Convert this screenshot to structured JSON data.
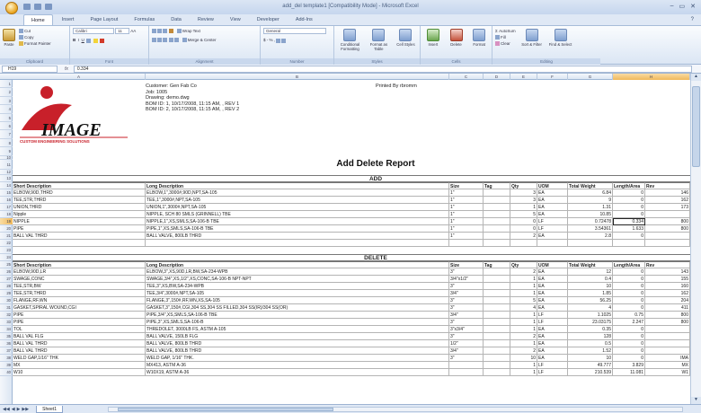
{
  "window": {
    "title": "add_del template1  [Compatibility Mode] - Microsoft Excel",
    "controls": [
      "–",
      "▭",
      "✕"
    ]
  },
  "ribbon": {
    "tabs": [
      "Home",
      "Insert",
      "Page Layout",
      "Formulas",
      "Data",
      "Review",
      "View",
      "Developer",
      "Add-Ins"
    ],
    "active_tab": "Home",
    "clipboard": {
      "paste": "Paste",
      "cut": "Cut",
      "copy": "Copy",
      "format_painter": "Format Painter",
      "label": "Clipboard"
    },
    "font": {
      "name": "Calibri",
      "size": "11",
      "label": "Font"
    },
    "alignment": {
      "wrap": "Wrap Text",
      "merge": "Merge & Center",
      "label": "Alignment"
    },
    "number": {
      "format": "General",
      "label": "Number"
    },
    "styles": {
      "conditional": "Conditional Formatting",
      "format_table": "Format as Table",
      "cell_styles": "Cell Styles",
      "label": "Styles"
    },
    "cells": {
      "insert": "Insert",
      "delete": "Delete",
      "format": "Format",
      "label": "Cells"
    },
    "editing": {
      "autosum": "AutoSum",
      "fill": "Fill",
      "clear": "Clear",
      "sort": "Sort & Filter",
      "find": "Find & Select",
      "label": "Editing"
    }
  },
  "formula_bar": {
    "cell_ref": "H19",
    "fx": "fx",
    "value": "0.334"
  },
  "columns": [
    "A",
    "B",
    "C",
    "D",
    "E",
    "F",
    "G",
    "H"
  ],
  "selected_column": "H",
  "selected_row": "19",
  "header": {
    "customer": "Customer:  Gen Fab Co",
    "job": "Job:  1005",
    "drawing": "Drawing:  demo.dwg",
    "bom1": "BOM ID:  1,  10/17/2008,  11:15 AM,  ,  REV 1",
    "bom2": "BOM ID:  2,  10/17/2008,  11:15 AM,  ,  REV 2",
    "printed_by": "Printed By rbromm",
    "logo_text": "IMAGE",
    "logo_sub": "CUSTOM ENGINEERING SOLUTIONS"
  },
  "report_title": "Add Delete Report",
  "add_section": {
    "label": "ADD",
    "headers": [
      "Short Description",
      "Long Description",
      "Size",
      "Tag",
      "Qty",
      "UOM",
      "Total Weight",
      "Length/Area",
      "Rev"
    ],
    "rows": [
      {
        "n": "14",
        "cells": []
      },
      {
        "n": "15",
        "cells": [
          "ELBOW,90D,THRD",
          "ELBOW,1\",3000#,90D,NPT,SA-105",
          "1\"",
          "",
          "3",
          "EA",
          "6.84",
          "0",
          "146"
        ]
      },
      {
        "n": "16",
        "cells": [
          "TEE,STR,THRD",
          "TEE,1\",3000#,NPT,SA-105",
          "1\"",
          "",
          "3",
          "EA",
          "9",
          "0",
          "162"
        ]
      },
      {
        "n": "17",
        "cells": [
          "UNION,THRD",
          "UNION,1\",3000#,NPT,SA-105",
          "1\"",
          "",
          "1",
          "EA",
          "1.31",
          "0",
          "173"
        ]
      },
      {
        "n": "18",
        "cells": [
          "Nipple",
          "NIPPLE, SCH 80 SMLS (GRINNELL) TBE",
          "1\"",
          "",
          "5",
          "EA",
          "10.85",
          "0",
          ""
        ]
      },
      {
        "n": "19",
        "cells": [
          "NIPPLE",
          "NIPPLE,1\",XS,SMLS,SA-106-B TBE",
          "1\"",
          "",
          "0",
          "LF",
          "0.72478",
          "0.334",
          "800"
        ]
      },
      {
        "n": "20",
        "cells": [
          "PIPE",
          "PIPE,1\",XS,SMLS,SA-106-B TBE",
          "1\"",
          "",
          "0",
          "LF",
          "3.54361",
          "1.633",
          "800"
        ]
      },
      {
        "n": "21",
        "cells": [
          "BALL VAL THRD",
          "BALL VALVE, 800LB THRD",
          "1\"",
          "",
          "2",
          "EA",
          "2.8",
          "0",
          ""
        ]
      }
    ]
  },
  "delete_section": {
    "label": "DELETE",
    "headers": [
      "Short Description",
      "Long Description",
      "Size",
      "Tag",
      "Qty",
      "UOM",
      "Total Weight",
      "Length/Area",
      "Rev"
    ],
    "rows": [
      {
        "n": "26",
        "cells": [
          "ELBOW,90D,LR",
          "ELBOW,3\",XS,90D,LR,BW,SA-234-WPB",
          "3\"",
          "",
          "2",
          "EA",
          "12",
          "0",
          "143"
        ]
      },
      {
        "n": "27",
        "cells": [
          "SWAGE,CONC",
          "SWAGE,3/4\",XS,1/2\",XS,CONC,SA-106-B NPT-NPT",
          "3/4\"x1/2\"",
          "",
          "1",
          "EA",
          "0.4",
          "0",
          "155"
        ]
      },
      {
        "n": "28",
        "cells": [
          "TEE,STR,BW",
          "TEE,3\",XS,BW,SA-234-WPB",
          "3\"",
          "",
          "1",
          "EA",
          "10",
          "0",
          "160"
        ]
      },
      {
        "n": "29",
        "cells": [
          "TEE,STR,THRD",
          "TEE,3/4\",3000#,NPT,SA-105",
          "3/4\"",
          "",
          "1",
          "EA",
          "1.85",
          "0",
          "162"
        ]
      },
      {
        "n": "30",
        "cells": [
          "FLANGE,RF,WN",
          "FLANGE,3\",150#,RF,WN,XS,SA-105",
          "3\"",
          "",
          "5",
          "EA",
          "56.25",
          "0",
          "204"
        ]
      },
      {
        "n": "31",
        "cells": [
          "GASKET,SPIRAL WOUND,CGI",
          "GASKET,3\",150#,CGI,304 SS,304 SS FILLED,304 SS(IR)/304 SS(OR)",
          "3\"",
          "",
          "4",
          "EA",
          "4",
          "0",
          "411"
        ]
      },
      {
        "n": "32",
        "cells": [
          "PIPE",
          "PIPE,3/4\",XS,SMLS,SA-106-B TBE",
          "3/4\"",
          "",
          "1",
          "LF",
          "1.1025",
          "0.75",
          "800"
        ]
      },
      {
        "n": "33",
        "cells": [
          "PIPE",
          "PIPE,3\",XS,SMLS,SA-106-B",
          "3\"",
          "",
          "1",
          "LF",
          "23.03175",
          "2.247",
          "800"
        ]
      },
      {
        "n": "34",
        "cells": [
          "TOL",
          "THREDOLET, 3000LB FS, ASTM A-105",
          "3\"x3/4\"",
          "",
          "1",
          "EA",
          "0.35",
          "0",
          ""
        ]
      },
      {
        "n": "35",
        "cells": [
          "BALL VAL FLG",
          "BALL VALVE, 150LB FLG",
          "3\"",
          "",
          "2",
          "EA",
          "128",
          "0",
          ""
        ]
      },
      {
        "n": "36",
        "cells": [
          "BALL VAL THRD",
          "BALL VALVE, 800LB THRD",
          "1/2\"",
          "",
          "1",
          "EA",
          "0.5",
          "0",
          ""
        ]
      },
      {
        "n": "37",
        "cells": [
          "BALL VAL THRD",
          "BALL VALVE, 800LB THRD",
          "3/4\"",
          "",
          "2",
          "EA",
          "1.52",
          "0",
          ""
        ]
      },
      {
        "n": "38",
        "cells": [
          "WELD GAP,1/16\" THK",
          "WELD GAP, 1/16\" THK.",
          "3\"",
          "",
          "10",
          "EA",
          "10",
          "0",
          "IMA"
        ]
      },
      {
        "n": "39",
        "cells": [
          "MX",
          "MX413, ASTM A-36",
          "",
          "",
          "1",
          "LF",
          "49.777",
          "3.829",
          "MX"
        ]
      },
      {
        "n": "40",
        "cells": [
          "W10",
          "W10X19, ASTM A-36",
          "",
          "",
          "1",
          "LF",
          "210.539",
          "11.081",
          "W1"
        ]
      }
    ]
  },
  "sheet_tab": "Sheet1"
}
